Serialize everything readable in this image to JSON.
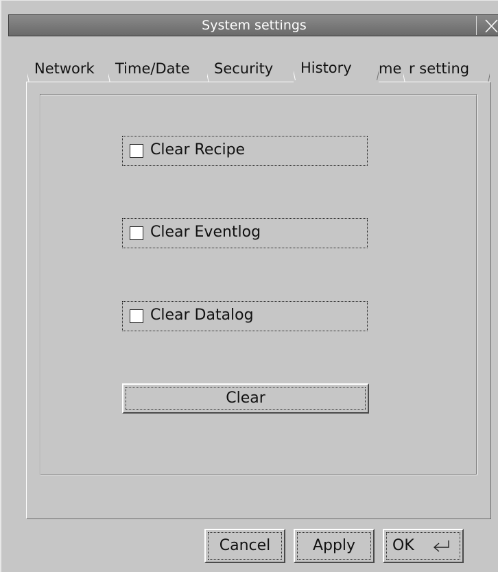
{
  "window": {
    "title": "System settings"
  },
  "tabs": [
    {
      "label": "Network",
      "active": false
    },
    {
      "label": "Time/Date",
      "active": false
    },
    {
      "label": "Security",
      "active": false
    },
    {
      "label": "History",
      "active": true
    },
    {
      "label": "me",
      "active": false
    },
    {
      "label": "r setting",
      "active": false
    }
  ],
  "history": {
    "options": [
      {
        "label": "Clear Recipe",
        "checked": false
      },
      {
        "label": "Clear Eventlog",
        "checked": false
      },
      {
        "label": "Clear Datalog",
        "checked": false
      }
    ],
    "clear_label": "Clear"
  },
  "footer": {
    "cancel_label": "Cancel",
    "apply_label": "Apply",
    "ok_label": "OK"
  },
  "icons": {
    "close": "close-icon",
    "enter": "enter-icon"
  }
}
